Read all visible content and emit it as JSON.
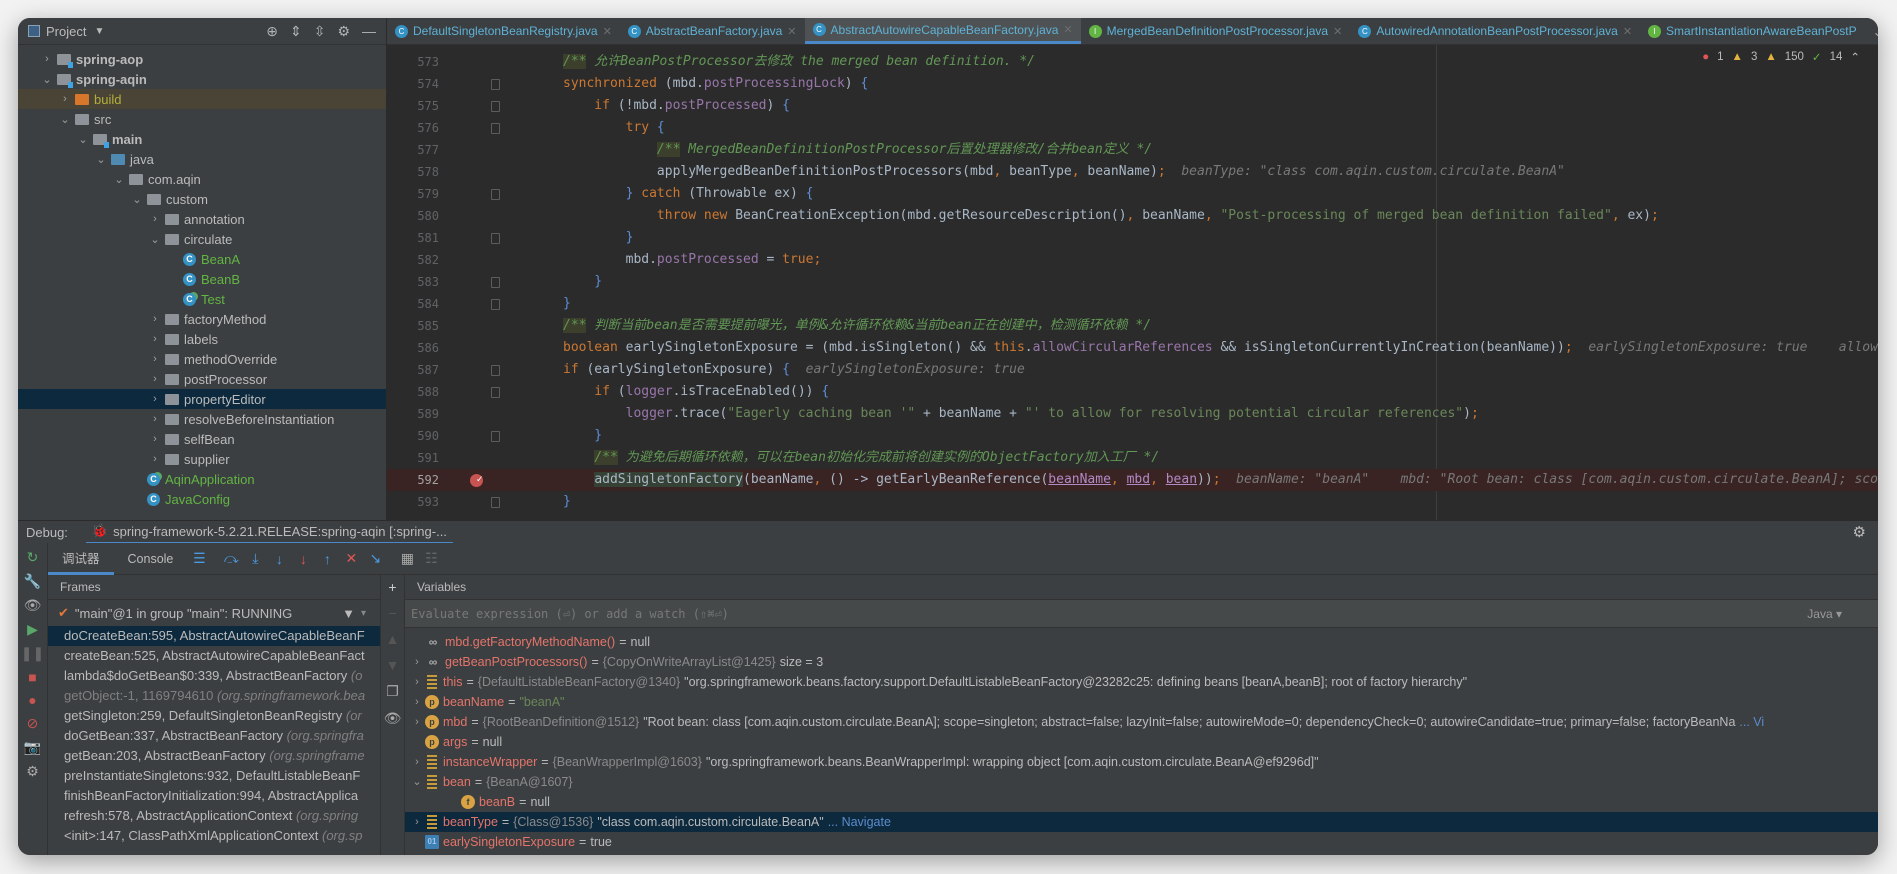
{
  "project": {
    "title": "Project",
    "tree": [
      {
        "label": "spring-aop",
        "level": 0,
        "chevron": "closed",
        "icon": "module-folder",
        "bold": true
      },
      {
        "label": "spring-aqin",
        "level": 0,
        "chevron": "open",
        "icon": "module-folder",
        "bold": true
      },
      {
        "label": "build",
        "level": 1,
        "chevron": "closed",
        "icon": "excluded-folder",
        "state": "excluded"
      },
      {
        "label": "src",
        "level": 1,
        "chevron": "open",
        "icon": "folder"
      },
      {
        "label": "main",
        "level": 2,
        "chevron": "open",
        "icon": "module-folder",
        "bold": true
      },
      {
        "label": "java",
        "level": 3,
        "chevron": "open",
        "icon": "source-folder"
      },
      {
        "label": "com.aqin",
        "level": 4,
        "chevron": "open",
        "icon": "package"
      },
      {
        "label": "custom",
        "level": 5,
        "chevron": "open",
        "icon": "package"
      },
      {
        "label": "annotation",
        "level": 6,
        "chevron": "closed",
        "icon": "package"
      },
      {
        "label": "circulate",
        "level": 6,
        "chevron": "open",
        "icon": "package"
      },
      {
        "label": "BeanA",
        "level": 7,
        "icon": "class",
        "color": "green"
      },
      {
        "label": "BeanB",
        "level": 7,
        "icon": "class",
        "color": "green"
      },
      {
        "label": "Test",
        "level": 7,
        "icon": "runnable-class",
        "color": "green"
      },
      {
        "label": "factoryMethod",
        "level": 6,
        "chevron": "closed",
        "icon": "package"
      },
      {
        "label": "labels",
        "level": 6,
        "chevron": "closed",
        "icon": "package"
      },
      {
        "label": "methodOverride",
        "level": 6,
        "chevron": "closed",
        "icon": "package"
      },
      {
        "label": "postProcessor",
        "level": 6,
        "chevron": "closed",
        "icon": "package"
      },
      {
        "label": "propertyEditor",
        "level": 6,
        "chevron": "closed",
        "icon": "package",
        "state": "selected"
      },
      {
        "label": "resolveBeforeInstantiation",
        "level": 6,
        "chevron": "closed",
        "icon": "package"
      },
      {
        "label": "selfBean",
        "level": 6,
        "chevron": "closed",
        "icon": "package"
      },
      {
        "label": "supplier",
        "level": 6,
        "chevron": "closed",
        "icon": "package"
      },
      {
        "label": "AqinApplication",
        "level": 5,
        "icon": "runnable-class",
        "color": "green"
      },
      {
        "label": "JavaConfig",
        "level": 5,
        "icon": "class",
        "color": "green"
      }
    ]
  },
  "editor": {
    "tabs": [
      {
        "label": "DefaultSingletonBeanRegistry.java",
        "icon": "class-icon"
      },
      {
        "label": "AbstractBeanFactory.java",
        "icon": "abstract-class-icon"
      },
      {
        "label": "AbstractAutowireCapableBeanFactory.java",
        "icon": "abstract-class-icon",
        "active": true
      },
      {
        "label": "MergedBeanDefinitionPostProcessor.java",
        "icon": "interface-icon"
      },
      {
        "label": "AutowiredAnnotationBeanPostProcessor.java",
        "icon": "class-icon"
      },
      {
        "label": "SmartInstantiationAwareBeanPostP",
        "icon": "interface-icon"
      }
    ],
    "inspections": {
      "errors": "1",
      "warnings": "3",
      "weak_warnings": "150",
      "typos": "14"
    },
    "breakpoint_line": "592",
    "execution_line": "592",
    "lines": [
      {
        "num": "573",
        "tokens": [
          [
            "/**",
            "cd"
          ],
          [
            " 允许BeanPostProcessor去修改 the merged bean definition. */",
            "c"
          ]
        ]
      },
      {
        "num": "574",
        "fold": "open",
        "tokens": [
          [
            "synchronized ",
            "k"
          ],
          [
            "(",
            "n"
          ],
          [
            "mbd.",
            "n"
          ],
          [
            "postProcessingLock",
            "f"
          ],
          [
            ") ",
            "n"
          ],
          [
            "{",
            "b"
          ]
        ]
      },
      {
        "num": "575",
        "fold": "open",
        "tokens": [
          [
            "    if ",
            "k"
          ],
          [
            "(!mbd.",
            "n"
          ],
          [
            "postProcessed",
            "f"
          ],
          [
            ") ",
            "n"
          ],
          [
            "{",
            "b"
          ]
        ]
      },
      {
        "num": "576",
        "fold": "open",
        "tokens": [
          [
            "        try ",
            "k"
          ],
          [
            "{",
            "b"
          ]
        ]
      },
      {
        "num": "577",
        "tokens": [
          [
            "            ",
            "n"
          ],
          [
            "/**",
            "cd"
          ],
          [
            " MergedBeanDefinitionPostProcessor后置处理器修改/合并bean定义 */",
            "c"
          ]
        ]
      },
      {
        "num": "578",
        "tokens": [
          [
            "            applyMergedBeanDefinitionPostProcessors(mbd",
            "n"
          ],
          [
            ", ",
            "k"
          ],
          [
            "beanType",
            "n"
          ],
          [
            ", ",
            "k"
          ],
          [
            "beanName)",
            "n"
          ],
          [
            ";",
            "k"
          ],
          [
            "  beanType: \"class com.aqin.custom.circulate.BeanA\"",
            "h"
          ]
        ]
      },
      {
        "num": "579",
        "fold": "open",
        "tokens": [
          [
            "        } ",
            "b"
          ],
          [
            "catch ",
            "k"
          ],
          [
            "(Throwable ex) ",
            "n"
          ],
          [
            "{",
            "b"
          ]
        ]
      },
      {
        "num": "580",
        "tokens": [
          [
            "            throw new ",
            "k"
          ],
          [
            "BeanCreationException(mbd.getResourceDescription()",
            "n"
          ],
          [
            ", ",
            "k"
          ],
          [
            "beanName",
            "n"
          ],
          [
            ", ",
            "k"
          ],
          [
            "\"Post-processing of merged bean definition failed\"",
            "s"
          ],
          [
            ", ",
            "k"
          ],
          [
            "ex)",
            "n"
          ],
          [
            ";",
            "k"
          ]
        ]
      },
      {
        "num": "581",
        "fold": "close",
        "tokens": [
          [
            "        }",
            "b"
          ]
        ]
      },
      {
        "num": "582",
        "tokens": [
          [
            "        mbd.",
            "n"
          ],
          [
            "postProcessed",
            "f"
          ],
          [
            " = ",
            "n"
          ],
          [
            "true",
            "k"
          ],
          [
            ";",
            "k"
          ]
        ]
      },
      {
        "num": "583",
        "fold": "close",
        "tokens": [
          [
            "    }",
            "b"
          ]
        ]
      },
      {
        "num": "584",
        "fold": "close",
        "tokens": [
          [
            "}",
            "b"
          ]
        ]
      },
      {
        "num": "585",
        "tokens": [
          [
            "/**",
            "cd"
          ],
          [
            " 判断当前bean是否需要提前曝光，单例&允许循环依赖&当前bean正在创建中，检测循环依赖 */",
            "c"
          ]
        ]
      },
      {
        "num": "586",
        "tokens": [
          [
            "boolean ",
            "k"
          ],
          [
            "earlySingletonExposure = (mbd.isSingleton() && ",
            "n"
          ],
          [
            "this",
            "k"
          ],
          [
            ".",
            "n"
          ],
          [
            "allowCircularReferences",
            "f"
          ],
          [
            " && isSingletonCurrentlyInCreation(beanName))",
            "n"
          ],
          [
            ";",
            "k"
          ],
          [
            "  earlySingletonExposure: true    allowC",
            "h"
          ]
        ]
      },
      {
        "num": "587",
        "fold": "open",
        "tokens": [
          [
            "if ",
            "k"
          ],
          [
            "(earlySingletonExposure) ",
            "n"
          ],
          [
            "{",
            "b"
          ],
          [
            "  earlySingletonExposure: true",
            "h"
          ]
        ]
      },
      {
        "num": "588",
        "fold": "open",
        "tokens": [
          [
            "    if ",
            "k"
          ],
          [
            "(",
            "n"
          ],
          [
            "logger",
            "f"
          ],
          [
            ".isTraceEnabled()) ",
            "n"
          ],
          [
            "{",
            "b"
          ]
        ]
      },
      {
        "num": "589",
        "tokens": [
          [
            "        ",
            "n"
          ],
          [
            "logger",
            "f"
          ],
          [
            ".trace(",
            "n"
          ],
          [
            "\"Eagerly caching bean '\"",
            "s"
          ],
          [
            " + beanName + ",
            "n"
          ],
          [
            "\"' to allow for resolving potential circular references\"",
            "s"
          ],
          [
            ")",
            "n"
          ],
          [
            ";",
            "k"
          ]
        ]
      },
      {
        "num": "590",
        "fold": "close",
        "tokens": [
          [
            "    }",
            "b"
          ]
        ]
      },
      {
        "num": "591",
        "tokens": [
          [
            "    ",
            "n"
          ],
          [
            "/**",
            "cd"
          ],
          [
            " 为避免后期循环依赖，可以在bean初始化完成前将创建实例的ObjectFactory加入工厂 */",
            "c"
          ]
        ]
      },
      {
        "num": "592",
        "tokens": [
          [
            "    ",
            "n"
          ],
          [
            "addSingletonFactory",
            "m"
          ],
          [
            "(beanName",
            "n"
          ],
          [
            ", ",
            "k"
          ],
          [
            "() -> getEarlyBeanReference(",
            "n"
          ],
          [
            "beanName",
            "u"
          ],
          [
            ", ",
            "k"
          ],
          [
            "mbd",
            "u"
          ],
          [
            ", ",
            "k"
          ],
          [
            "bean",
            "u"
          ],
          [
            "))",
            "n"
          ],
          [
            ";",
            "k"
          ],
          [
            "  beanName: \"beanA\"    mbd: \"Root bean: class [com.aqin.custom.circulate.BeanA]; scop",
            "h"
          ]
        ]
      },
      {
        "num": "593",
        "fold": "close",
        "tokens": [
          [
            "}",
            "b"
          ]
        ]
      }
    ]
  },
  "debug": {
    "label": "Debug:",
    "config": "spring-framework-5.2.21.RELEASE:spring-aqin [:spring-...",
    "tabs": [
      "调试器",
      "Console"
    ],
    "frames_title": "Frames",
    "variables_title": "Variables",
    "thread": "\"main\"@1 in group \"main\": RUNNING",
    "frames": [
      {
        "method": "doCreateBean:595, AbstractAutowireCapableBeanF",
        "pkg": "",
        "selected": true
      },
      {
        "method": "createBean:525, AbstractAutowireCapableBeanFact",
        "pkg": ""
      },
      {
        "method": "lambda$doGetBean$0:339, AbstractBeanFactory ",
        "pkg": "(o"
      },
      {
        "method": "getObject:-1, 1169794610 ",
        "pkg": "(org.springframework.bea",
        "dim": true
      },
      {
        "method": "getSingleton:259, DefaultSingletonBeanRegistry ",
        "pkg": "(or"
      },
      {
        "method": "doGetBean:337, AbstractBeanFactory ",
        "pkg": "(org.springfra"
      },
      {
        "method": "getBean:203, AbstractBeanFactory ",
        "pkg": "(org.springframe"
      },
      {
        "method": "preInstantiateSingletons:932, DefaultListableBeanF",
        "pkg": ""
      },
      {
        "method": "finishBeanFactoryInitialization:994, AbstractApplica",
        "pkg": ""
      },
      {
        "method": "refresh:578, AbstractApplicationContext ",
        "pkg": "(org.spring"
      },
      {
        "method": "<init>:147, ClassPathXmlApplicationContext ",
        "pkg": "(org.sp"
      }
    ],
    "evaluate_placeholder": "Evaluate expression (⏎) or add a watch (⇧⌘⏎)",
    "language": "Java",
    "variables": [
      {
        "icon": "watch",
        "name": "mbd.getFactoryMethodName()",
        "type": "",
        "value": "null",
        "chevron": "none"
      },
      {
        "icon": "watch",
        "name": "getBeanPostProcessors()",
        "type": "{CopyOnWriteArrayList@1425}",
        "value": " size = 3",
        "chevron": "closed"
      },
      {
        "icon": "obj",
        "name": "this",
        "type": "{DefaultListableBeanFactory@1340}",
        "value": "\"org.springframework.beans.factory.support.DefaultListableBeanFactory@23282c25: defining beans [beanA,beanB]; root of factory hierarchy\"",
        "chevron": "closed"
      },
      {
        "icon": "p",
        "name": "beanName",
        "type": "",
        "value": "\"beanA\"",
        "string": true,
        "chevron": "closed"
      },
      {
        "icon": "p",
        "name": "mbd",
        "type": "{RootBeanDefinition@1512}",
        "value": "\"Root bean: class [com.aqin.custom.circulate.BeanA]; scope=singleton; abstract=false; lazyInit=false; autowireMode=0; dependencyCheck=0; autowireCandidate=true; primary=false; factoryBeanNa",
        "link": "... Vi",
        "chevron": "closed"
      },
      {
        "icon": "p",
        "name": "args",
        "type": "",
        "value": "null",
        "chevron": "none"
      },
      {
        "icon": "obj",
        "name": "instanceWrapper",
        "type": "{BeanWrapperImpl@1603}",
        "value": "\"org.springframework.beans.BeanWrapperImpl: wrapping object [com.aqin.custom.circulate.BeanA@ef9296d]\"",
        "chevron": "closed"
      },
      {
        "icon": "obj",
        "name": "bean",
        "type": "{BeanA@1607}",
        "value": "",
        "chevron": "open"
      },
      {
        "icon": "fld",
        "name": "beanB",
        "type": "",
        "value": "null",
        "chevron": "none",
        "nested": true
      },
      {
        "icon": "obj",
        "name": "beanType",
        "type": "{Class@1536}",
        "value": "\"class com.aqin.custom.circulate.BeanA\"",
        "link": "... Navigate",
        "chevron": "closed",
        "selected": true
      },
      {
        "icon": "bool",
        "name": "earlySingletonExposure",
        "type": "",
        "value": "true",
        "chevron": "none"
      }
    ]
  }
}
